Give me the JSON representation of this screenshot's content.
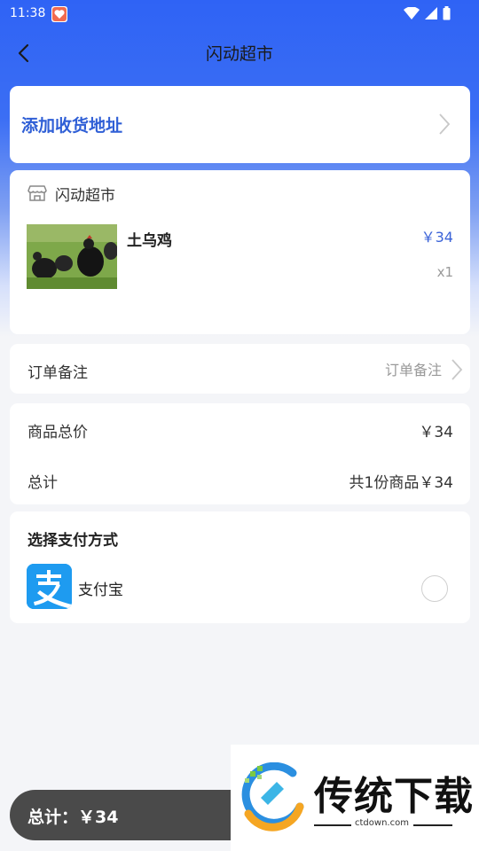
{
  "status_bar": {
    "time": "11:38"
  },
  "header": {
    "title": "闪动超市"
  },
  "address": {
    "label": "添加收货地址"
  },
  "store": {
    "name": "闪动超市",
    "product": {
      "name": "土乌鸡",
      "price": "￥34",
      "quantity": "x1"
    }
  },
  "remark": {
    "label": "订单备注",
    "placeholder": "订单备注"
  },
  "summary": {
    "subtotal_label": "商品总价",
    "subtotal_value": "￥34",
    "total_label": "总计",
    "total_value": "共1份商品￥34"
  },
  "payment": {
    "title": "选择支付方式",
    "options": [
      {
        "label": "支付宝",
        "icon": "alipay-icon",
        "selected": false
      }
    ]
  },
  "footer": {
    "total_text": "总计：￥34"
  },
  "watermark": {
    "text": "传统下载",
    "url": "ctdown.com"
  },
  "colors": {
    "accent": "#2f63f5",
    "link": "#2f5fd6",
    "price": "#3b63d8",
    "alipay": "#1e9bf0"
  }
}
